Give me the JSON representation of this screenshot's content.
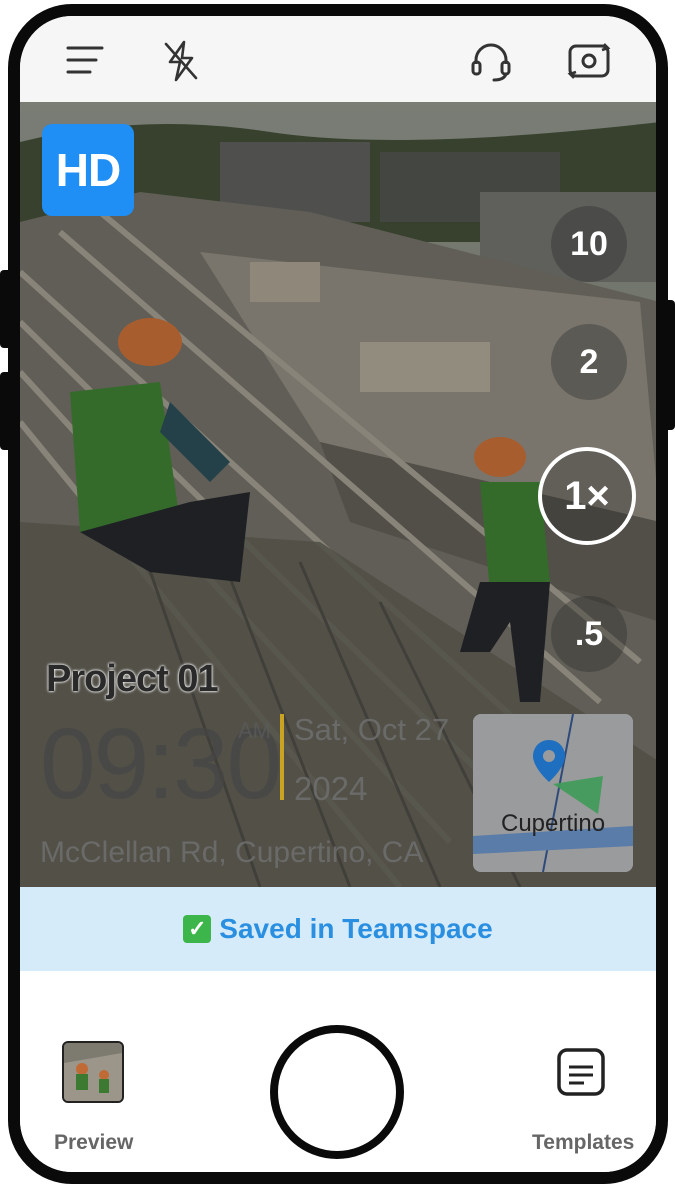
{
  "topbar": {
    "menu_icon": "hamburger-menu-icon",
    "flash_icon": "flash-off-icon",
    "support_icon": "headset-icon",
    "camera_switch_icon": "camera-rotate-icon"
  },
  "viewfinder": {
    "hd_badge": "HD",
    "zoom_levels": [
      "10",
      "2",
      "1×",
      ".5"
    ],
    "active_zoom": "1×"
  },
  "watermark": {
    "project": "Project 01",
    "time": "09:30",
    "ampm": "AM",
    "date": "Sat, Oct 27",
    "year": "2024",
    "address": "McClellan Rd, Cupertino, CA",
    "map_label": "Cupertino",
    "accent_color": "#c9a321"
  },
  "status": {
    "saved_text": "Saved in Teamspace",
    "color": "#2a8fe0",
    "bg": "#d5ebfa"
  },
  "bottom": {
    "preview_label": "Preview",
    "templates_label": "Templates"
  }
}
